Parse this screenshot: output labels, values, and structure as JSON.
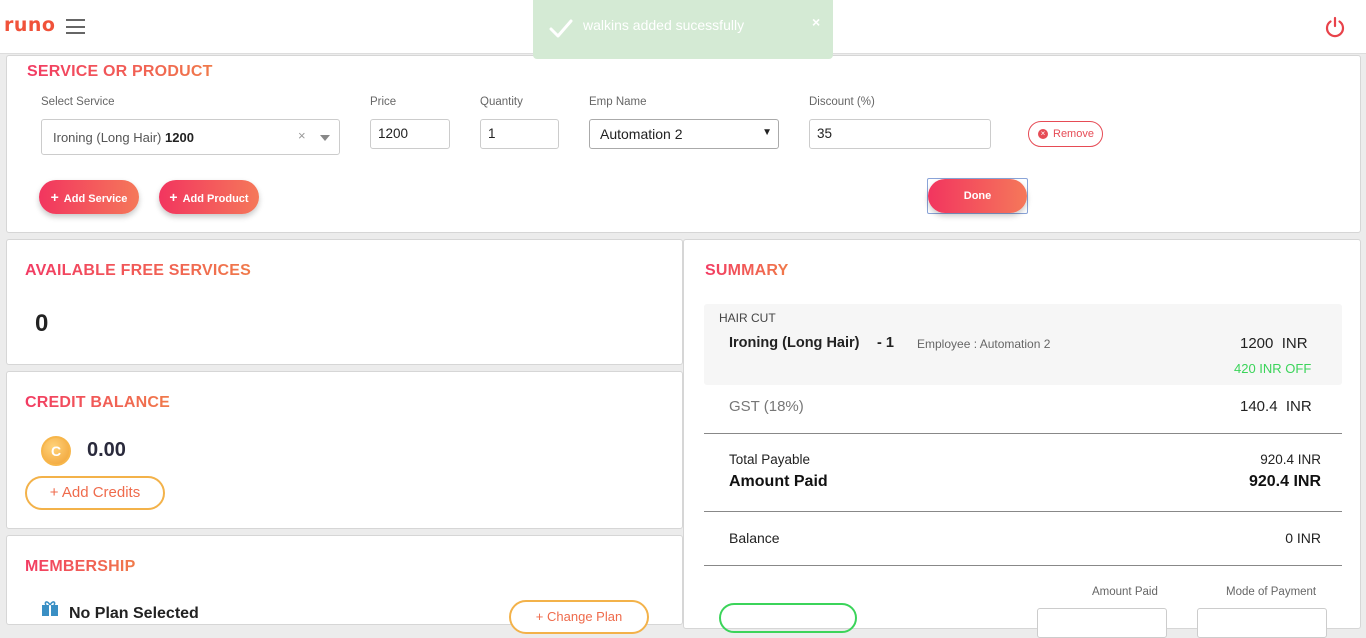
{
  "app": {
    "logo": "runo"
  },
  "toast": {
    "message": "walkins added sucessfully",
    "close": "×"
  },
  "service_section": {
    "title": "SERVICE OR PRODUCT",
    "labels": {
      "service": "Select Service",
      "price": "Price",
      "quantity": "Quantity",
      "emp": "Emp Name",
      "discount": "Discount (%)"
    },
    "service_name": "Ironing (Long Hair)",
    "service_price": "1200",
    "clear": "×",
    "price": "1200",
    "quantity": "1",
    "emp": "Automation 2",
    "discount": "35",
    "remove": "Remove",
    "add_service": "Add Service",
    "add_product": "Add Product",
    "done": "Done"
  },
  "free_services": {
    "title": "AVAILABLE FREE SERVICES",
    "count": "0"
  },
  "credit": {
    "title": "CREDIT BALANCE",
    "coin_letter": "C",
    "balance": "0.00",
    "add": "Add Credits"
  },
  "membership": {
    "title": "MEMBERSHIP",
    "plan": "No Plan Selected",
    "change": "Change Plan"
  },
  "summary": {
    "title": "SUMMARY",
    "category": "HAIR CUT",
    "item_name": "Ironing (Long Hair)",
    "item_qty": "- 1",
    "employee": "Employee : Automation 2",
    "item_price": "1200",
    "currency": "INR",
    "discount_note": "420 INR OFF",
    "gst_label": "GST (18%)",
    "gst_value": "140.4",
    "total_label": "Total Payable",
    "total_value": "920.4 INR",
    "paid_label": "Amount Paid",
    "paid_value": "920.4 INR",
    "balance_label": "Balance",
    "balance_value": "0 INR",
    "col_amount_paid": "Amount Paid",
    "col_mode": "Mode of Payment"
  },
  "colors": {
    "accent_start": "#f2355f",
    "accent_end": "#f5785a",
    "success": "#3bd45a",
    "toast_bg": "#d4ead4"
  }
}
